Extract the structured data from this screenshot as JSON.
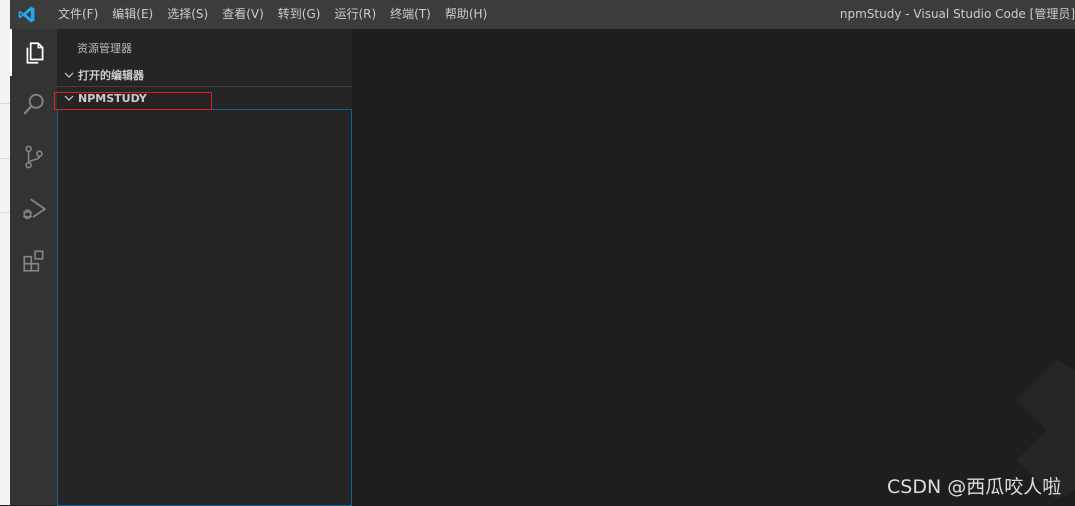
{
  "titlebar": {
    "menu": [
      {
        "label": "文件(F)"
      },
      {
        "label": "编辑(E)"
      },
      {
        "label": "选择(S)"
      },
      {
        "label": "查看(V)"
      },
      {
        "label": "转到(G)"
      },
      {
        "label": "运行(R)"
      },
      {
        "label": "终端(T)"
      },
      {
        "label": "帮助(H)"
      }
    ],
    "window_title": "npmStudy - Visual Studio Code [管理员]"
  },
  "activitybar": {
    "items": [
      {
        "icon": "explorer-icon",
        "active": true
      },
      {
        "icon": "search-icon"
      },
      {
        "icon": "source-control-icon"
      },
      {
        "icon": "run-debug-icon"
      },
      {
        "icon": "extensions-icon"
      }
    ]
  },
  "sidebar": {
    "title": "资源管理器",
    "sections": [
      {
        "label": "打开的编辑器"
      },
      {
        "label": "NPMSTUDY"
      }
    ]
  },
  "watermark": "CSDN @西瓜咬人啦",
  "colors": {
    "titlebar": "#3c3c3c",
    "activitybar": "#333333",
    "sidebar": "#252526",
    "editor": "#1e1e1e",
    "accent": "#0e639c",
    "highlight": "#e02020",
    "logo": "#23a9f2"
  }
}
